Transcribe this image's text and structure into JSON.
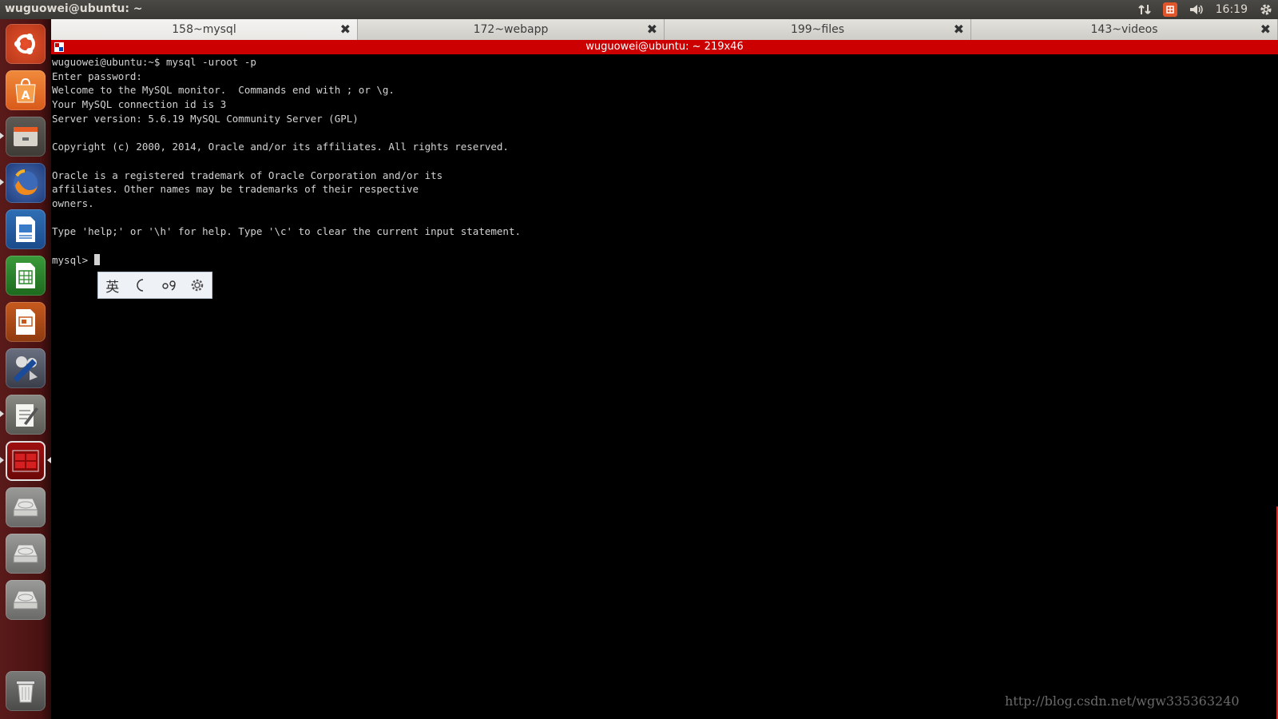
{
  "top_panel": {
    "window_title": "wuguowei@ubuntu: ~",
    "clock": "16:19",
    "indicators": [
      "network-icon",
      "input-method-icon",
      "volume-icon",
      "settings-gear-icon"
    ]
  },
  "launcher": {
    "items": [
      {
        "name": "ubuntu-dash-icon"
      },
      {
        "name": "software-center-icon"
      },
      {
        "name": "files-icon"
      },
      {
        "name": "firefox-icon"
      },
      {
        "name": "libreoffice-writer-icon"
      },
      {
        "name": "libreoffice-calc-icon"
      },
      {
        "name": "libreoffice-impress-icon"
      },
      {
        "name": "video-editor-icon"
      },
      {
        "name": "text-editor-icon"
      },
      {
        "name": "terminal-icon"
      },
      {
        "name": "drive-icon"
      },
      {
        "name": "drive-icon"
      },
      {
        "name": "drive-icon"
      },
      {
        "name": "trash-icon"
      }
    ]
  },
  "tabs": [
    {
      "label": "158~mysql",
      "active": true
    },
    {
      "label": "172~webapp",
      "active": false
    },
    {
      "label": "199~files",
      "active": false
    },
    {
      "label": "143~videos",
      "active": false
    }
  ],
  "terminal": {
    "title": "wuguowei@ubuntu: ~ 219x46",
    "lines": [
      "wuguowei@ubuntu:~$ mysql -uroot -p",
      "Enter password:",
      "Welcome to the MySQL monitor.  Commands end with ; or \\g.",
      "Your MySQL connection id is 3",
      "Server version: 5.6.19 MySQL Community Server (GPL)",
      "",
      "Copyright (c) 2000, 2014, Oracle and/or its affiliates. All rights reserved.",
      "",
      "Oracle is a registered trademark of Oracle Corporation and/or its",
      "affiliates. Other names may be trademarks of their respective",
      "owners.",
      "",
      "Type 'help;' or '\\h' for help. Type '\\c' to clear the current input statement.",
      ""
    ],
    "prompt": "mysql> "
  },
  "ime_toolbar": {
    "mode_label": "英"
  },
  "watermark": "http://blog.csdn.net/wgw335363240",
  "colors": {
    "titlebar": "#cc0000",
    "launcher": "#4a1212",
    "terminal_bg": "#000000",
    "terminal_fg": "#d3d3d3"
  }
}
